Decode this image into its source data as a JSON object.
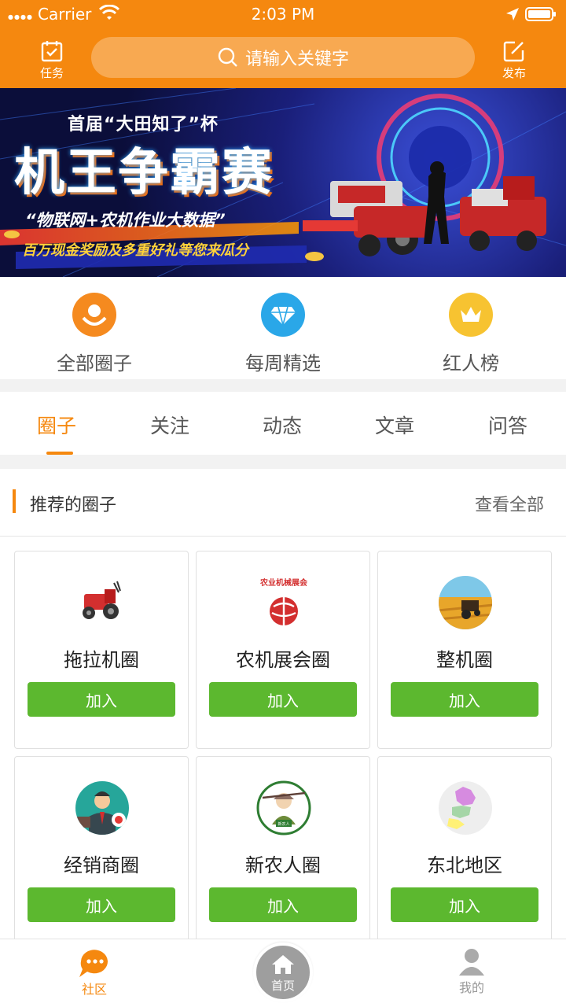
{
  "status_bar": {
    "carrier": "Carrier",
    "time": "2:03 PM"
  },
  "header": {
    "left_button": {
      "label": "任务",
      "icon": "task-icon"
    },
    "search_placeholder": "请输入关键字",
    "right_button": {
      "label": "发布",
      "icon": "edit-icon"
    },
    "accent_color": "#f5880f"
  },
  "banner": {
    "line1": "首届“大田知了”杯",
    "line2": "机王争霸赛",
    "line3": "“物联网+农机作业大数据”",
    "line4": "百万现金奖励及多重好礼等您来瓜分"
  },
  "categories": [
    {
      "label": "全部圈子",
      "icon": "circle-group-icon",
      "color": "#f58a1f"
    },
    {
      "label": "每周精选",
      "icon": "diamond-icon",
      "color": "#2aa7e8"
    },
    {
      "label": "红人榜",
      "icon": "crown-icon",
      "color": "#f7c331"
    }
  ],
  "tabs": [
    {
      "label": "圈子",
      "active": true
    },
    {
      "label": "关注",
      "active": false
    },
    {
      "label": "动态",
      "active": false
    },
    {
      "label": "文章",
      "active": false
    },
    {
      "label": "问答",
      "active": false
    }
  ],
  "section": {
    "title": "推荐的圈子",
    "more": "查看全部"
  },
  "circles": [
    {
      "name": "拖拉机圈",
      "join": "加入",
      "icon": "tractor-icon"
    },
    {
      "name": "农机展会圈",
      "join": "加入",
      "icon": "expo-logo-icon",
      "logo_text": "农业机械展会"
    },
    {
      "name": "整机圈",
      "join": "加入",
      "icon": "field-tractor-icon"
    },
    {
      "name": "经销商圈",
      "join": "加入",
      "icon": "dealer-icon"
    },
    {
      "name": "新农人圈",
      "join": "加入",
      "icon": "farmer-icon",
      "logo_text": "新农人"
    },
    {
      "name": "东北地区",
      "join": "加入",
      "icon": "map-northeast-icon"
    }
  ],
  "tabbar": {
    "community": "社区",
    "home": "首页",
    "me": "我的"
  },
  "join_color": "#5cb82f"
}
